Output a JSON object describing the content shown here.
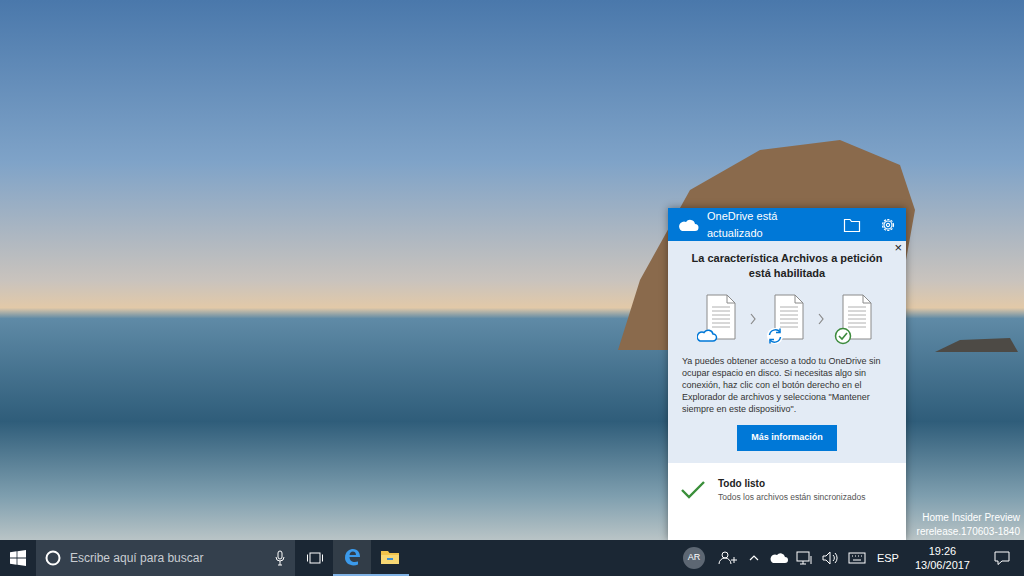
{
  "desktop": {
    "watermark": [
      "Home Insider Preview",
      "rerelease.170603-1840"
    ]
  },
  "flyout": {
    "status": "OneDrive está actualizado",
    "close": "×",
    "notice": {
      "title": "La característica Archivos a petición está habilitada",
      "body": "Ya puedes obtener acceso a todo tu OneDrive sin ocupar espacio en disco. Si necesitas algo sin conexión, haz clic con el botón derecho en el Explorador de archivos y selecciona \"Mantener siempre en este dispositivo\".",
      "button": "Más información"
    },
    "sync": {
      "title": "Todo listo",
      "detail": "Todos los archivos están sincronizados"
    }
  },
  "taskbar": {
    "search": {
      "placeholder": "Escribe aquí para buscar"
    },
    "avatar": "AR",
    "language": "ESP",
    "time": "19:26",
    "date": "13/06/2017"
  }
}
